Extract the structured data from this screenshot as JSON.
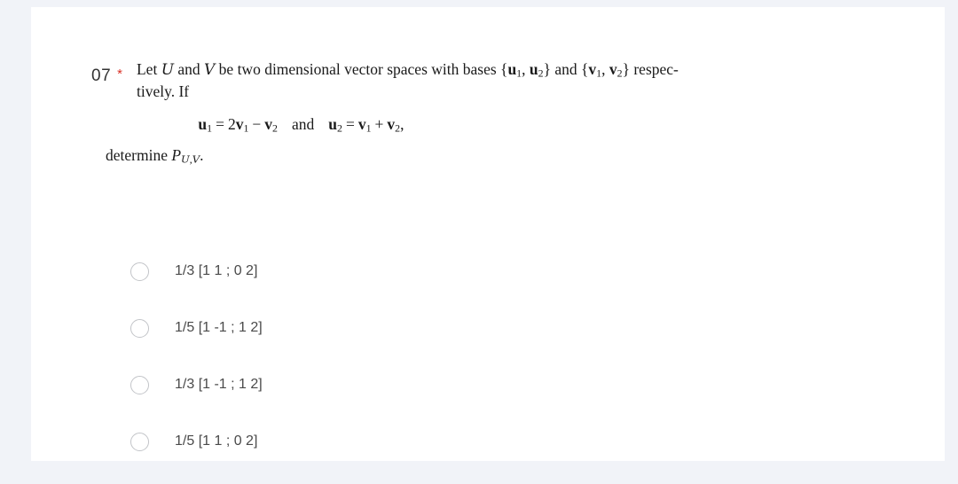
{
  "card": {
    "background_color": "#ffffff",
    "page_background_color": "#f1f3f8"
  },
  "question": {
    "number": "07",
    "required_marker": "*",
    "required_marker_color": "#d93025",
    "line1_part1": "Let ",
    "space_u": "U",
    "line1_part2": " and ",
    "space_v": "V",
    "line1_part3": " be two dimensional vector spaces with bases ",
    "basis_u_open": "{",
    "basis_u_1": "u",
    "basis_u_1_sub": "1",
    "basis_u_comma": ", ",
    "basis_u_2": "u",
    "basis_u_2_sub": "2",
    "basis_u_close": "}",
    "line1_part4": " and ",
    "basis_v_open": "{",
    "basis_v_1": "v",
    "basis_v_1_sub": "1",
    "basis_v_comma": ", ",
    "basis_v_2": "v",
    "basis_v_2_sub": "2",
    "basis_v_close": "}",
    "line1_part5": " respec-",
    "line2": "tively. If",
    "equation": {
      "lhs1": "u",
      "lhs1_sub": "1",
      "eq1": "=",
      "coef": "2",
      "rhs1a": "v",
      "rhs1a_sub": "1",
      "minus": "−",
      "rhs1b": "v",
      "rhs1b_sub": "2",
      "conjunction": "and",
      "lhs2": "u",
      "lhs2_sub": "2",
      "eq2": "=",
      "rhs2a": "v",
      "rhs2a_sub": "1",
      "plus": "+",
      "rhs2b": "v",
      "rhs2b_sub": "2",
      "trailing_comma": ","
    },
    "determine_text": "determine ",
    "determine_symbol": "P",
    "determine_sub_u": "U",
    "determine_sub_comma": ",",
    "determine_sub_v": "V",
    "determine_period": "."
  },
  "options": [
    {
      "label": "1/3 [1 1 ; 0 2]",
      "selected": false
    },
    {
      "label": "1/5 [1 -1 ; 1 2]",
      "selected": false
    },
    {
      "label": "1/3 [1 -1 ; 1 2]",
      "selected": false
    },
    {
      "label": "1/5 [1 1 ; 0 2]",
      "selected": false
    }
  ]
}
